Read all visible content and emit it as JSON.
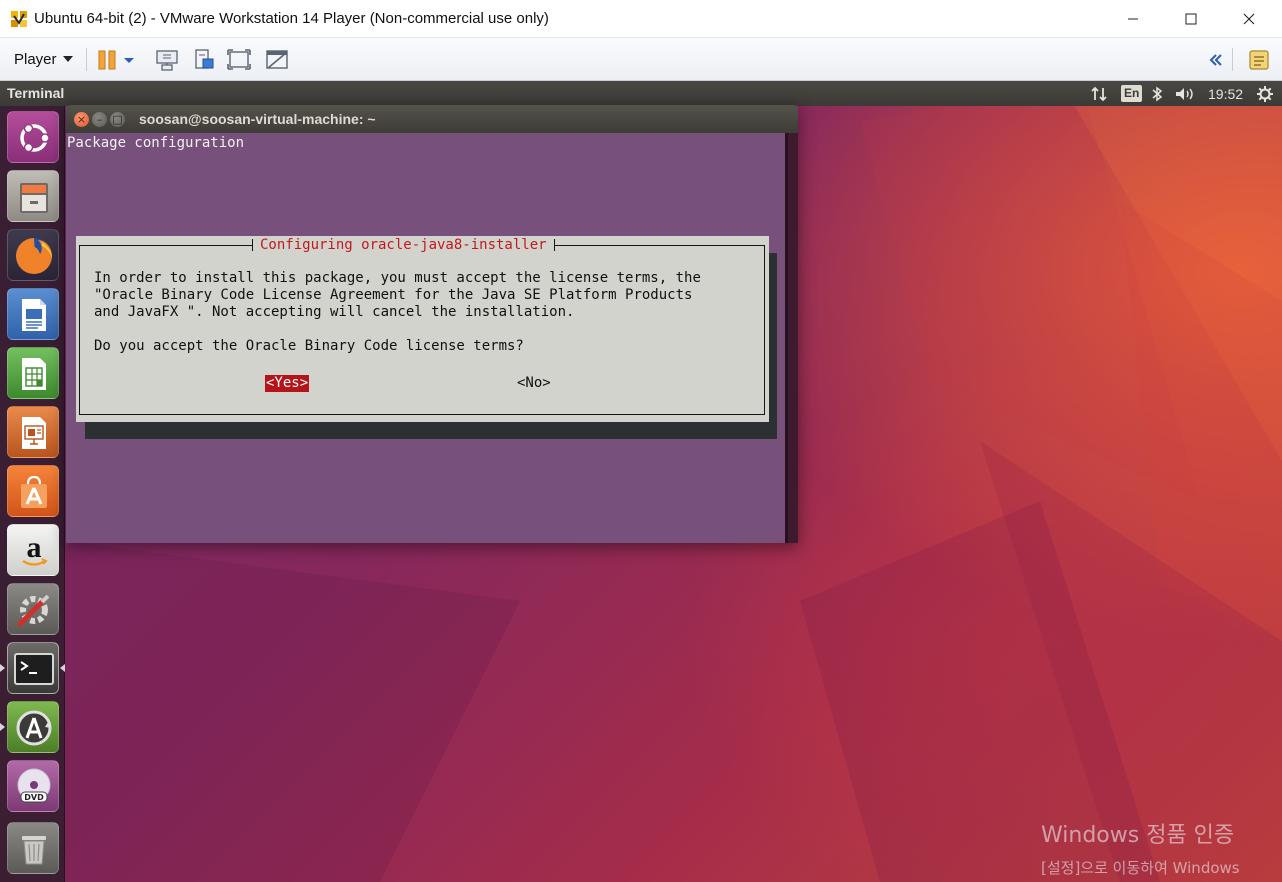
{
  "host_window": {
    "title": "Ubuntu 64-bit (2) - VMware Workstation 14 Player (Non-commercial use only)",
    "app_icon": "vmware-player-icon",
    "controls": [
      "minimize-icon",
      "maximize-icon",
      "close-icon"
    ]
  },
  "vm_toolbar": {
    "player_label": "Player",
    "icons": [
      "pause-icon",
      "pause-dropdown-icon",
      "send-ctrl-alt-del-icon",
      "removable-devices-icon",
      "fullscreen-icon",
      "unity-icon",
      "collapse-toolbar-icon",
      "vm-library-icon"
    ]
  },
  "ubuntu_panel": {
    "app_title": "Terminal",
    "keyboard_layout": "En",
    "clock": "19:52",
    "indicators": [
      "network-icon",
      "keyboard-layout-indicator",
      "bluetooth-icon",
      "volume-icon",
      "clock",
      "system-gear-icon"
    ]
  },
  "launcher": {
    "items": [
      {
        "name": "ubuntu-dash",
        "icon": "ubuntu-logo-icon"
      },
      {
        "name": "files",
        "icon": "file-cabinet-icon"
      },
      {
        "name": "firefox",
        "icon": "firefox-icon"
      },
      {
        "name": "libreoffice-writer",
        "icon": "writer-icon"
      },
      {
        "name": "libreoffice-calc",
        "icon": "calc-icon"
      },
      {
        "name": "libreoffice-impress",
        "icon": "impress-icon"
      },
      {
        "name": "ubuntu-software",
        "icon": "software-center-icon"
      },
      {
        "name": "amazon",
        "icon": "amazon-icon"
      },
      {
        "name": "system-settings",
        "icon": "settings-tools-icon"
      },
      {
        "name": "terminal",
        "icon": "terminal-icon",
        "active": true
      },
      {
        "name": "software-updater",
        "icon": "updater-icon"
      },
      {
        "name": "dvd",
        "icon": "dvd-icon"
      },
      {
        "name": "trash",
        "icon": "trash-icon"
      }
    ]
  },
  "terminal": {
    "title": "soosan@soosan-virtual-machine: ~",
    "heading": "Package configuration",
    "dialog": {
      "title": "Configuring oracle-java8-installer",
      "lines": [
        "In order to install this package, you must accept the license terms, the",
        "\"Oracle Binary Code License Agreement for the Java SE Platform Products",
        "and JavaFX \". Not accepting will cancel the installation.",
        "",
        "Do you accept the Oracle Binary Code license terms?"
      ],
      "yes_label": "<Yes>",
      "no_label": "<No>",
      "selected": "yes"
    }
  },
  "watermark": {
    "title": "Windows 정품 인증",
    "subtitle": "[설정]으로 이동하여 Windows"
  },
  "colors": {
    "terminal_bg": "#77507b",
    "dialog_bg": "#d3d3cd",
    "dialog_title": "#c2191f",
    "selected_button": "#b5141a",
    "panel_bg": "#3c3b37"
  }
}
